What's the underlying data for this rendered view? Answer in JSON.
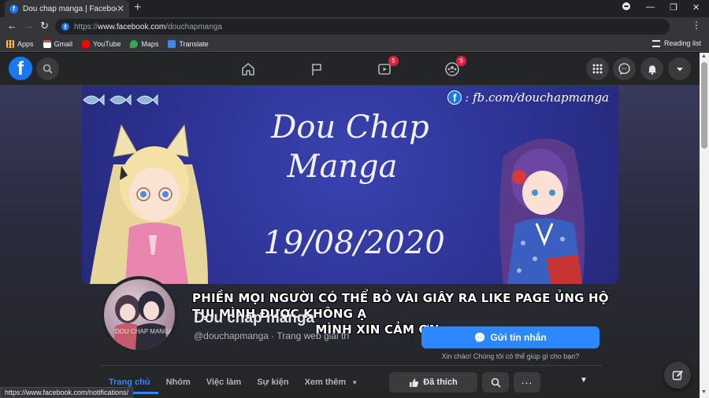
{
  "browser": {
    "tab_title": "Dou chap manga | Facebook",
    "url_prefix": "https://",
    "url_host": "www.facebook.com",
    "url_path": "/douchapmanga",
    "bookmarks": [
      {
        "label": "Apps",
        "icon": "apps-grid-icon"
      },
      {
        "label": "Gmail",
        "icon": "gmail-icon"
      },
      {
        "label": "YouTube",
        "icon": "youtube-icon"
      },
      {
        "label": "Maps",
        "icon": "maps-icon"
      },
      {
        "label": "Translate",
        "icon": "translate-icon"
      }
    ],
    "reading_list": "Reading list",
    "status_url": "https://www.facebook.com/notifications/"
  },
  "fb_header": {
    "watch_badge": "5",
    "groups_badge": "9"
  },
  "cover": {
    "title_line1": "Dou Chap",
    "title_line2": "Manga",
    "date": "19/08/2020",
    "handle": ": fb.com/douchapmanga"
  },
  "overlay": {
    "line1": "Phiền mọi người có thể bỏ vài giây ra like page ủng hộ tụi mình được không ạ",
    "line2": "Mình xin cảm ơn"
  },
  "avatar": {
    "watermark": "DOU CHAP MANGA"
  },
  "page": {
    "name": "Dou chap manga",
    "subtitle": "@douchapmanga · Trang web giải trí",
    "message_button": "Gửi tin nhắn",
    "greeting": "Xin chào! Chúng tôi có thể giúp gì cho bạn?",
    "like_button": "Đã thích"
  },
  "tabs": [
    {
      "label": "Trang chủ"
    },
    {
      "label": "Nhóm"
    },
    {
      "label": "Việc làm"
    },
    {
      "label": "Sự kiện"
    },
    {
      "label": "Xem thêm"
    }
  ],
  "colors": {
    "fb_blue": "#1877f2",
    "message_button": "#2d88ff",
    "badge": "#e41e3f"
  }
}
